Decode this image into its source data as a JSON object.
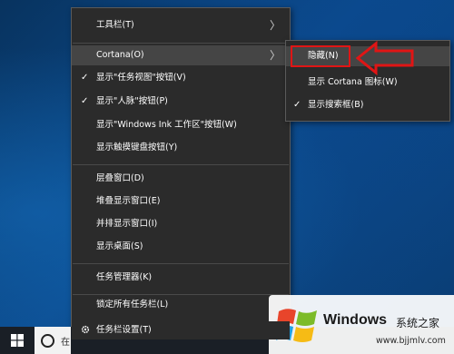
{
  "context_menu": {
    "items": [
      {
        "label": "工具栏(T)",
        "checked": false,
        "submenu": true
      },
      {
        "label": "Cortana(O)",
        "checked": false,
        "submenu": true,
        "highlighted": true
      },
      {
        "label": "显示\"任务视图\"按钮(V)",
        "checked": true
      },
      {
        "label": "显示\"人脉\"按钮(P)",
        "checked": true
      },
      {
        "label": "显示\"Windows Ink 工作区\"按钮(W)",
        "checked": false
      },
      {
        "label": "显示触摸键盘按钮(Y)",
        "checked": false
      },
      {
        "label": "层叠窗口(D)",
        "checked": false
      },
      {
        "label": "堆叠显示窗口(E)",
        "checked": false
      },
      {
        "label": "并排显示窗口(I)",
        "checked": false
      },
      {
        "label": "显示桌面(S)",
        "checked": false
      },
      {
        "label": "任务管理器(K)",
        "checked": false
      },
      {
        "label": "锁定所有任务栏(L)",
        "checked": true
      },
      {
        "label": "任务栏设置(T)",
        "icon": "gear-icon"
      }
    ]
  },
  "cortana_submenu": {
    "items": [
      {
        "label": "隐藏(N)",
        "checked": false,
        "highlighted": true
      },
      {
        "label": "显示 Cortana 图标(W)",
        "checked": false
      },
      {
        "label": "显示搜索框(B)",
        "checked": true
      }
    ]
  },
  "glyphs": {
    "check": "✓",
    "arrow": "〉"
  },
  "taskbar": {
    "search_text": "在",
    "start_icon": "windows-logo-icon",
    "search_icon": "search-circle-icon"
  },
  "watermark": {
    "title": "Windows",
    "subtitle": "系统之家",
    "url": "www.bjjmlv.com"
  },
  "colors": {
    "menu_bg": "#2b2b2b",
    "highlight": "#454545",
    "annotation": "#e01515"
  }
}
